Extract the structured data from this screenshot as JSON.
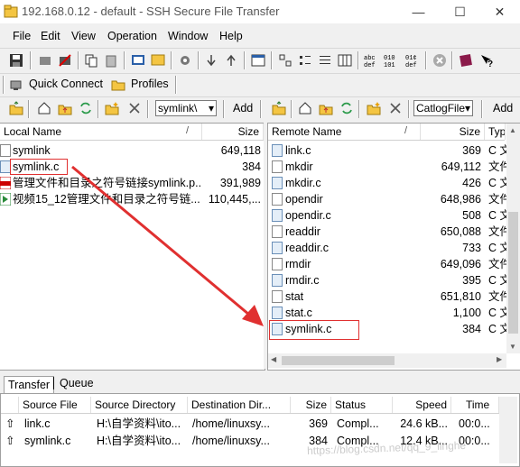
{
  "window": {
    "title": "192.168.0.12 - default - SSH Secure File Transfer",
    "minimize": "—",
    "maximize": "☐",
    "close": "✕"
  },
  "menu": [
    "File",
    "Edit",
    "View",
    "Operation",
    "Window",
    "Help"
  ],
  "quickbar": {
    "quick_connect": "Quick Connect",
    "profiles": "Profiles"
  },
  "local": {
    "path_value": "symlink\\",
    "add_label": "Add",
    "headers": {
      "name": "Local Name",
      "sort": "/",
      "size": "Size"
    },
    "rows": [
      {
        "name": "symlink",
        "size": "649,118",
        "icon": "file-icon"
      },
      {
        "name": "symlink.c",
        "size": "384",
        "icon": "c-file-icon"
      },
      {
        "name": "管理文件和目录之符号链接symlink.p...",
        "size": "391,989",
        "icon": "pdf-icon"
      },
      {
        "name": "视频15_12管理文件和目录之符号链...",
        "size": "110,445,...",
        "icon": "video-icon"
      }
    ]
  },
  "remote": {
    "path_value": "CatlogFile",
    "add_label": "Add",
    "headers": {
      "name": "Remote Name",
      "sort": "/",
      "size": "Size",
      "type": "Typ"
    },
    "rows": [
      {
        "name": "link.c",
        "size": "369",
        "type": "C 文"
      },
      {
        "name": "mkdir",
        "size": "649,112",
        "type": "文件"
      },
      {
        "name": "mkdir.c",
        "size": "426",
        "type": "C 文"
      },
      {
        "name": "opendir",
        "size": "648,986",
        "type": "文件"
      },
      {
        "name": "opendir.c",
        "size": "508",
        "type": "C 文"
      },
      {
        "name": "readdir",
        "size": "650,088",
        "type": "文件"
      },
      {
        "name": "readdir.c",
        "size": "733",
        "type": "C 文"
      },
      {
        "name": "rmdir",
        "size": "649,096",
        "type": "文件"
      },
      {
        "name": "rmdir.c",
        "size": "395",
        "type": "C 文"
      },
      {
        "name": "stat",
        "size": "651,810",
        "type": "文件"
      },
      {
        "name": "stat.c",
        "size": "1,100",
        "type": "C 文"
      },
      {
        "name": "symlink.c",
        "size": "384",
        "type": "C 文"
      }
    ]
  },
  "tabs": {
    "transfer": "Transfer",
    "queue": "Queue"
  },
  "transfer": {
    "headers": {
      "source_file": "Source File",
      "source_dir": "Source Directory",
      "dest_dir": "Destination Dir...",
      "size": "Size",
      "status": "Status",
      "speed": "Speed",
      "time": "Time"
    },
    "rows": [
      {
        "source_file": "link.c",
        "source_dir": "H:\\自学资料\\ito...",
        "dest_dir": "/home/linuxsy...",
        "size": "369",
        "status": "Compl...",
        "speed": "24.6 kB...",
        "time": "00:0..."
      },
      {
        "source_file": "symlink.c",
        "source_dir": "H:\\自学资料\\ito...",
        "dest_dir": "/home/linuxsy...",
        "size": "384",
        "status": "Compl...",
        "speed": "12.4 kB...",
        "time": "00:0..."
      }
    ]
  },
  "watermark": "https://blog.csdn.net/qq_9_linghe",
  "colors": {
    "annotation_red": "#e03030",
    "selection_blue": "#0078d7"
  }
}
